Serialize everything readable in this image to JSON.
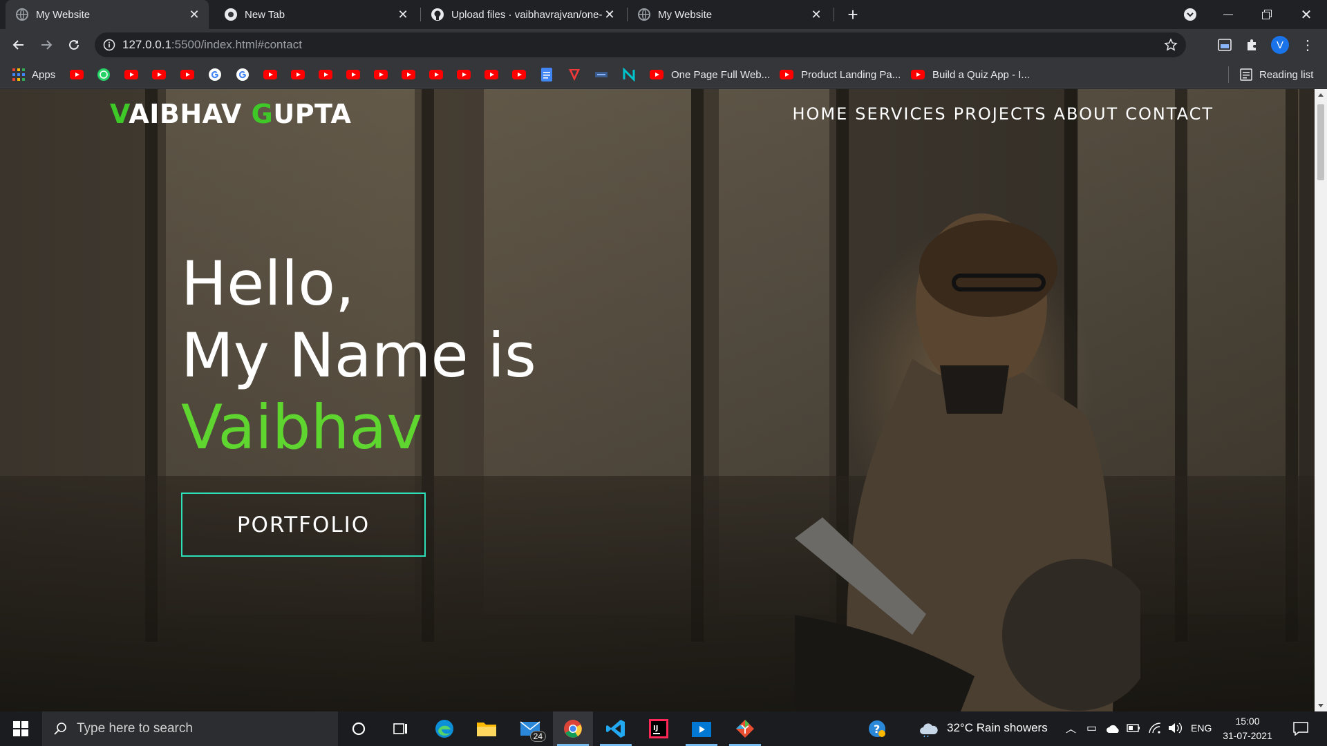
{
  "browser": {
    "tabs": [
      {
        "title": "My Website",
        "active": true
      },
      {
        "title": "New Tab",
        "active": false
      },
      {
        "title": "Upload files · vaibhavrajvan/one-",
        "active": false
      },
      {
        "title": "My Website",
        "active": false
      }
    ],
    "url_host": "127.0.0.1",
    "url_path": ":5500/index.html#contact",
    "profile_initial": "V"
  },
  "bookmarks": {
    "apps_label": "Apps",
    "items": [
      {
        "label": "One Page Full Web..."
      },
      {
        "label": "Product Landing Pa..."
      },
      {
        "label": "Build a Quiz App - I..."
      }
    ],
    "reading_list": "Reading list"
  },
  "site": {
    "brand_first_initial": "V",
    "brand_first_rest": "AIBHAV ",
    "brand_last_initial": "G",
    "brand_last_rest": "UPTA",
    "nav": [
      "HOME",
      "SERVICES",
      "PROJECTS",
      "ABOUT",
      "CONTACT"
    ],
    "hero_line1": "Hello,",
    "hero_line2": "My Name is",
    "hero_name": "Vaibhav",
    "cta": "PORTFOLIO",
    "accent": "#5fd52f",
    "button_border": "#2ee0b9"
  },
  "taskbar": {
    "search_placeholder": "Type here to search",
    "mail_badge": "24",
    "weather_temp": "32°C",
    "weather_desc": "Rain showers",
    "lang": "ENG",
    "time": "15:00",
    "date": "31-07-2021"
  }
}
